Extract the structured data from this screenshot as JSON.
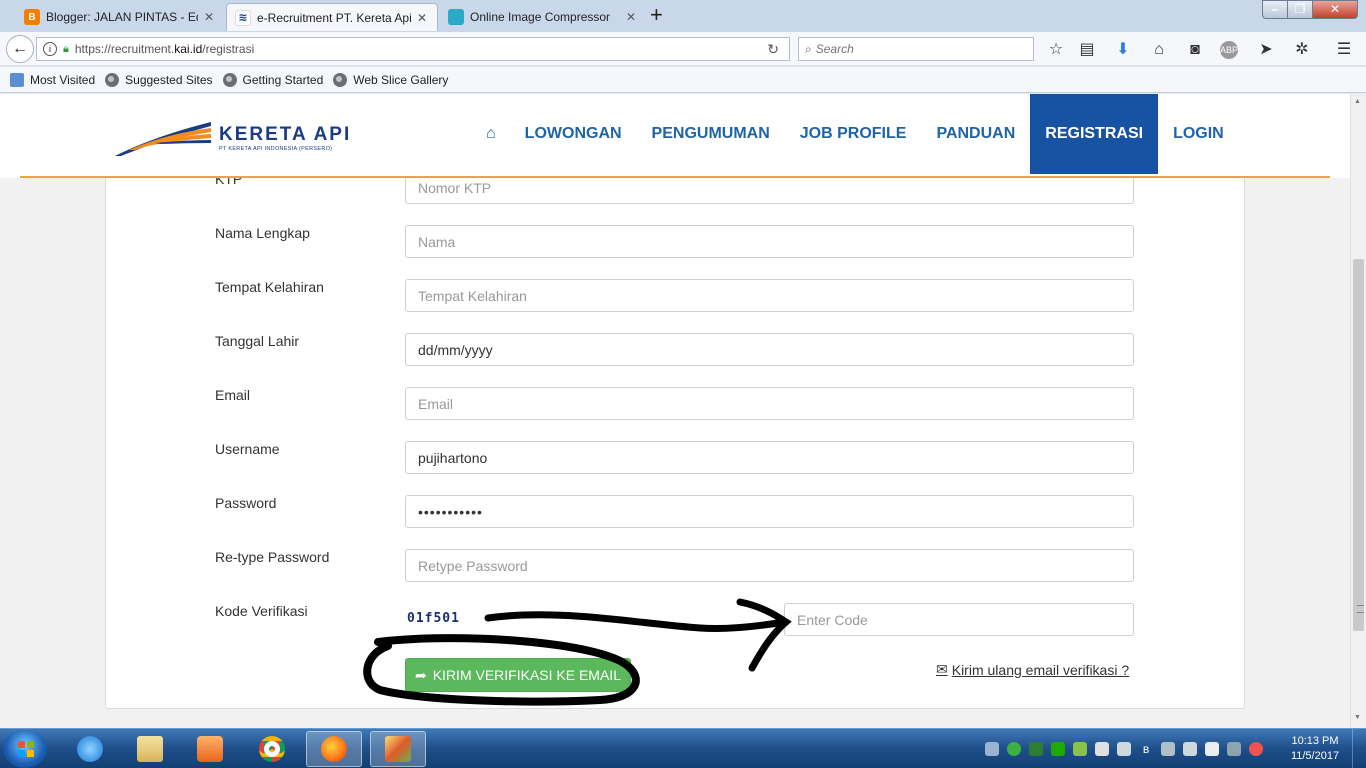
{
  "browser": {
    "tabs": [
      {
        "title": "Blogger: JALAN PINTAS - Edi",
        "favicon_color": "#f57d00"
      },
      {
        "title": "e-Recruitment PT. Kereta Api",
        "favicon_color": "#1a3b86"
      },
      {
        "title": "Online Image Compressor",
        "favicon_color": "#2aa9c9"
      }
    ],
    "new_tab_glyph": "+",
    "url_prefix": "https://recruitment.",
    "url_domain": "kai.id",
    "url_path": "/registrasi",
    "search_placeholder": "Search",
    "bookmarks": [
      "Most Visited",
      "Suggested Sites",
      "Getting Started",
      "Web Slice Gallery"
    ]
  },
  "site": {
    "logo_title": "KERETA API",
    "logo_subtitle": "PT KERETA API INDONESIA (PERSERO)",
    "nav": {
      "home_icon": "⌂",
      "items": [
        "LOWONGAN",
        "PENGUMUMAN",
        "JOB PROFILE",
        "PANDUAN",
        "REGISTRASI",
        "LOGIN"
      ],
      "active": "REGISTRASI"
    },
    "colors": {
      "nav_text": "#2064a8",
      "nav_active_bg": "#1752a3",
      "accent_line": "#e1a93f",
      "submit_green": "#5cb85c"
    }
  },
  "form": {
    "fields": [
      {
        "label": "KTP",
        "placeholder": "Nomor KTP",
        "value": ""
      },
      {
        "label": "Nama Lengkap",
        "placeholder": "Nama",
        "value": ""
      },
      {
        "label": "Tempat Kelahiran",
        "placeholder": "Tempat Kelahiran",
        "value": ""
      },
      {
        "label": "Tanggal Lahir",
        "placeholder": "",
        "value": "dd/mm/yyyy"
      },
      {
        "label": "Email",
        "placeholder": "Email",
        "value": ""
      },
      {
        "label": "Username",
        "placeholder": "",
        "value": "pujihartono"
      },
      {
        "label": "Password",
        "placeholder": "",
        "value": "•••••••••••"
      },
      {
        "label": "Re-type Password",
        "placeholder": "Retype Password",
        "value": ""
      }
    ],
    "verification": {
      "label": "Kode Verifikasi",
      "captcha": "01f501",
      "placeholder": "Enter Code"
    },
    "submit_label": "KIRIM VERIFIKASI KE EMAIL",
    "resend_label": "Kirim ulang email verifikasi ?"
  },
  "taskbar": {
    "clock_time": "10:13 PM",
    "clock_date": "11/5/2017",
    "apps": [
      "internet-explorer",
      "file-explorer",
      "media-player",
      "chrome",
      "firefox",
      "paint"
    ]
  }
}
